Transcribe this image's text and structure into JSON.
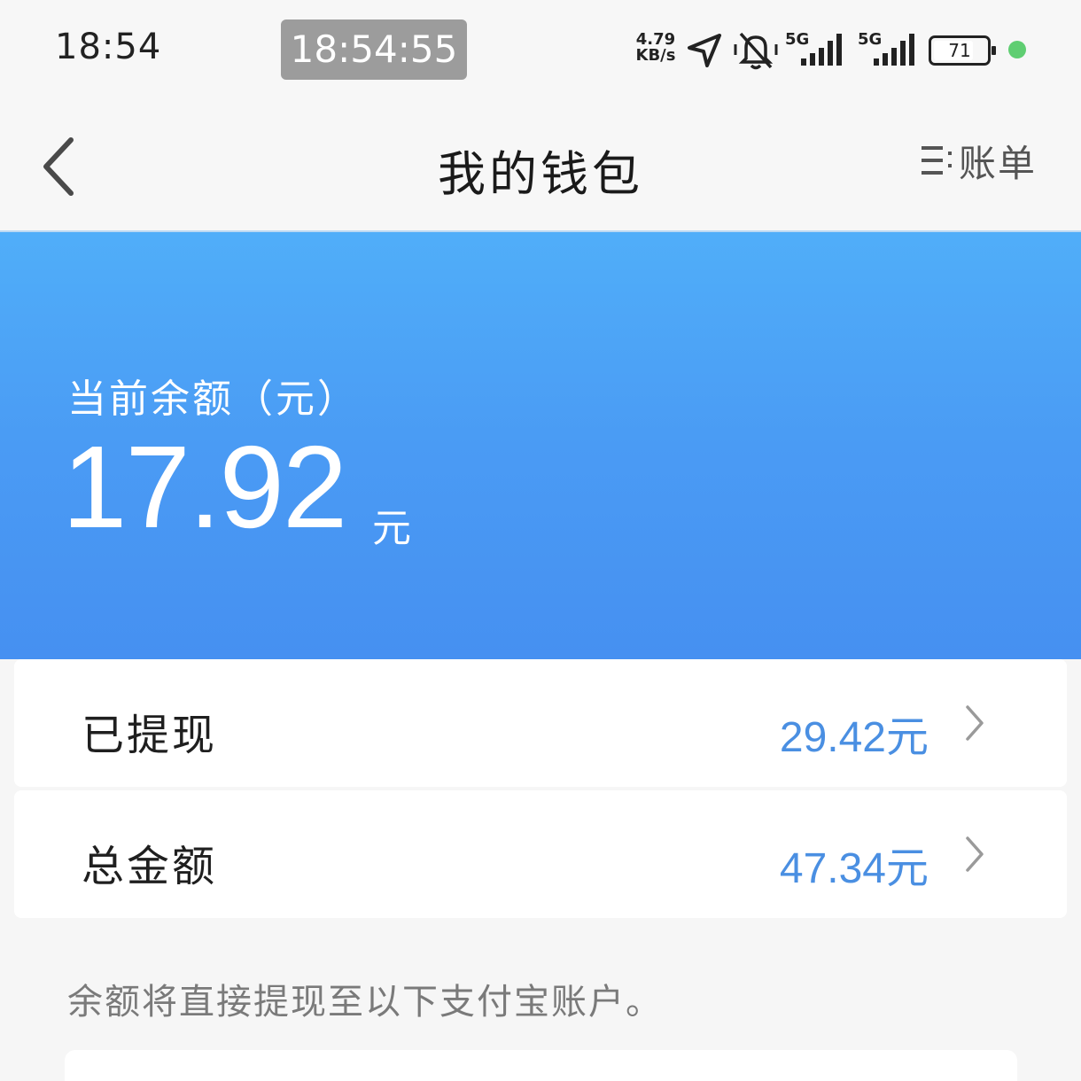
{
  "status_bar": {
    "time": "18:54",
    "clock_chip": "18:54:55",
    "net_speed_value": "4.79",
    "net_speed_unit": "KB/s",
    "network_1": "5G",
    "network_2": "5G",
    "battery": "71",
    "icons": [
      "location-arrow-icon",
      "mute-bell-icon",
      "signal-icon",
      "signal-icon",
      "battery-icon",
      "green-dot-icon"
    ]
  },
  "nav": {
    "title": "我的钱包",
    "bill_label": "账单",
    "icons": [
      "back-chevron-icon",
      "list-icon"
    ]
  },
  "balance": {
    "label": "当前余额（元）",
    "amount": "17.92",
    "unit": "元"
  },
  "rows": [
    {
      "label": "已提现",
      "value": "29.42元"
    },
    {
      "label": "总金额",
      "value": "47.34元"
    }
  ],
  "hint": "余额将直接提现至以下支付宝账户。",
  "colors": {
    "hero_top": "#50aef9",
    "hero_bottom": "#4690f1",
    "value_blue": "#4a8fe2",
    "status_dot": "#5fce72"
  }
}
